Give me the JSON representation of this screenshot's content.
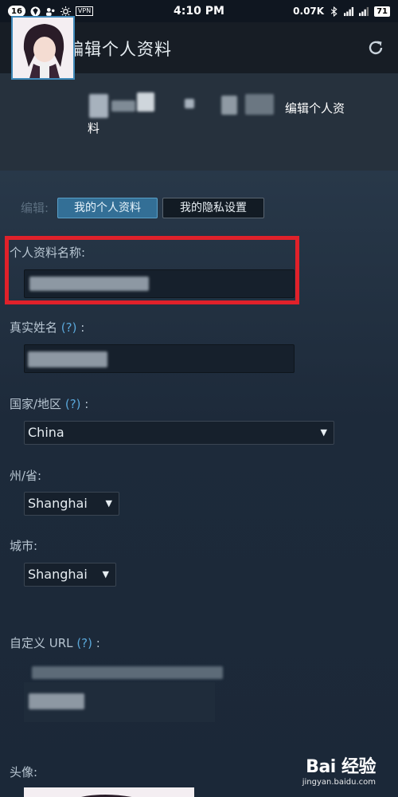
{
  "status_bar": {
    "notif_count": "16",
    "time": "4:10 PM",
    "net_speed": "0.07K",
    "vpn": "VPN",
    "battery": "71"
  },
  "app_bar": {
    "title": "编辑个人资料"
  },
  "profile_header": {
    "edit_link_part1": "编辑个人资",
    "edit_link_part2": "料"
  },
  "tabs": {
    "edit_label": "编辑:",
    "my_profile": "我的个人资料",
    "privacy": "我的隐私设置"
  },
  "fields": {
    "profile_name_label": "个人资料名称:",
    "real_name_label": "真实姓名",
    "country_label": "国家/地区",
    "country_value": "China",
    "state_label": "州/省:",
    "state_value": "Shanghai",
    "city_label": "城市:",
    "city_value": "Shanghai",
    "custom_url_label": "自定义 URL",
    "avatar_label": "头像:",
    "help_mark": "(?)",
    "colon": ":"
  },
  "watermark": {
    "main": "Bai 经验",
    "sub": "jingyan.baidu.com"
  },
  "colors": {
    "background": "#1b2838",
    "accent": "#336f96",
    "highlight": "#e0212a"
  }
}
